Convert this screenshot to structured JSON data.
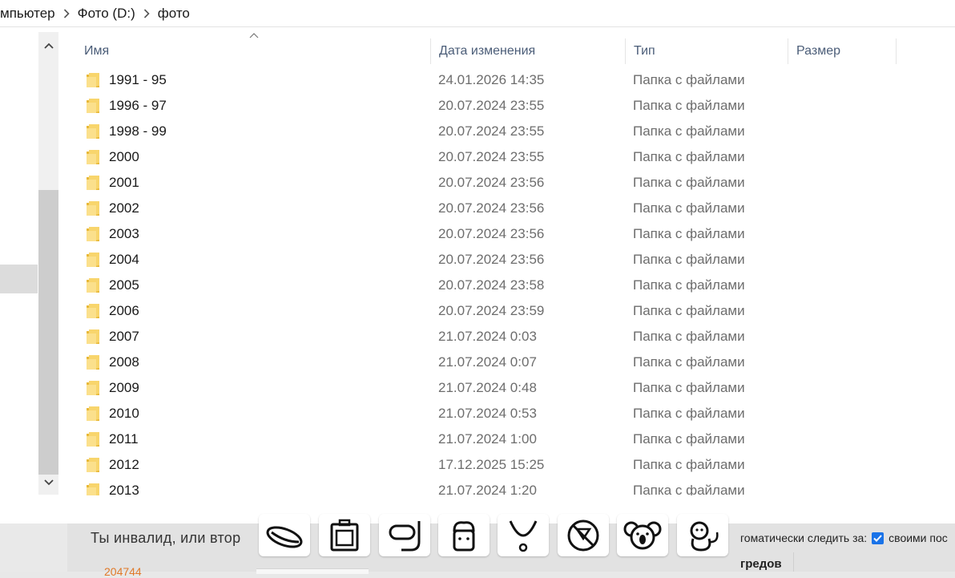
{
  "breadcrumb": {
    "items": [
      "мпьютер",
      "Фото (D:)",
      "фото"
    ]
  },
  "columns": {
    "name": "Имя",
    "date": "Дата изменения",
    "type": "Тип",
    "size": "Размер"
  },
  "rows": [
    {
      "name": "1991 - 95",
      "date": "24.01.2026 14:35",
      "type": "Папка с файлами"
    },
    {
      "name": "1996 - 97",
      "date": "20.07.2024 23:55",
      "type": "Папка с файлами"
    },
    {
      "name": "1998 - 99",
      "date": "20.07.2024 23:55",
      "type": "Папка с файлами"
    },
    {
      "name": "2000",
      "date": "20.07.2024 23:55",
      "type": "Папка с файлами"
    },
    {
      "name": "2001",
      "date": "20.07.2024 23:56",
      "type": "Папка с файлами"
    },
    {
      "name": "2002",
      "date": "20.07.2024 23:56",
      "type": "Папка с файлами"
    },
    {
      "name": "2003",
      "date": "20.07.2024 23:56",
      "type": "Папка с файлами"
    },
    {
      "name": "2004",
      "date": "20.07.2024 23:56",
      "type": "Папка с файлами"
    },
    {
      "name": "2005",
      "date": "20.07.2024 23:58",
      "type": "Папка с файлами"
    },
    {
      "name": "2006",
      "date": "20.07.2024 23:59",
      "type": "Папка с файлами"
    },
    {
      "name": "2007",
      "date": "21.07.2024 0:03",
      "type": "Папка с файлами"
    },
    {
      "name": "2008",
      "date": "21.07.2024 0:07",
      "type": "Папка с файлами"
    },
    {
      "name": "2009",
      "date": "21.07.2024 0:48",
      "type": "Папка с файлами"
    },
    {
      "name": "2010",
      "date": "21.07.2024 0:53",
      "type": "Папка с файлами"
    },
    {
      "name": "2011",
      "date": "21.07.2024 1:00",
      "type": "Папка с файлами"
    },
    {
      "name": "2012",
      "date": "17.12.2025 15:25",
      "type": "Папка с файлами"
    },
    {
      "name": "2013",
      "date": "21.07.2024 1:20",
      "type": "Папка с файлами"
    }
  ],
  "background_page": {
    "post_text": "Ты инвалид, или втор",
    "partial_number": "204744",
    "follow_label": "гоматически следить за:",
    "own_posts_label": "своими пос",
    "threads_label": "гредов",
    "emoji_icons": [
      "hotdog-icon",
      "suitcase-icon",
      "snorkel-mask-icon",
      "chef-icon",
      "necklace-icon",
      "no-drinking-icon",
      "koala-icon",
      "monkey-icon"
    ]
  },
  "colors": {
    "header_text": "#4b5d78",
    "folder_yellow": "#f8d56c",
    "checkbox": "#1a73e8"
  }
}
